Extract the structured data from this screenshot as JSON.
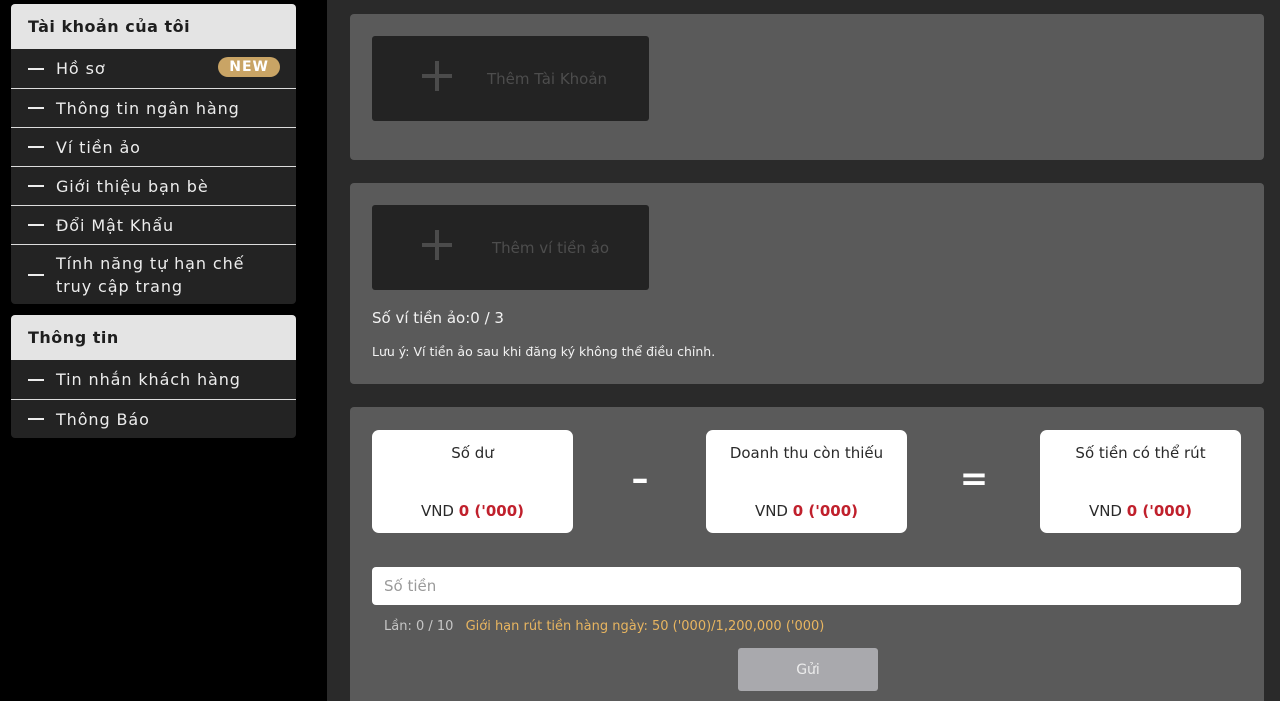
{
  "sidebar": {
    "account_panel": {
      "title": "Tài khoản của tôi",
      "items": [
        {
          "label": "Hồ sơ",
          "badge": "NEW"
        },
        {
          "label": "Thông tin ngân hàng"
        },
        {
          "label": "Ví tiền ảo"
        },
        {
          "label": "Giới thiệu bạn bè"
        },
        {
          "label": "Đổi Mật Khẩu"
        },
        {
          "label": "Tính năng tự hạn chế truy cập trang"
        }
      ]
    },
    "info_panel": {
      "title": "Thông tin",
      "items": [
        {
          "label": "Tin nhắn khách hàng"
        },
        {
          "label": "Thông Báo"
        }
      ]
    }
  },
  "main": {
    "add_account_label": "Thêm Tài Khoản",
    "add_wallet_label": "Thêm ví tiền ảo",
    "wallet_count_text": "Số ví tiền ảo:0 / 3",
    "wallet_note": "Lưu ý: Ví tiền ảo sau khi đăng ký không thể điều chỉnh.",
    "balance": {
      "title": "Số dư",
      "currency": "VND",
      "value": "0 ('000)"
    },
    "minus_symbol": "–",
    "shortfall": {
      "title": "Doanh thu còn thiếu",
      "currency": "VND",
      "value": "0 ('000)"
    },
    "equals_symbol": "=",
    "withdrawable": {
      "title": "Số tiền có thể rút",
      "currency": "VND",
      "value": "0 ('000)"
    },
    "amount_placeholder": "Số tiền",
    "times_text": "Lần: 0 / 10",
    "daily_limit_text": "Giới hạn rút tiền hàng ngày: 50 ('000)/1,200,000 ('000)",
    "submit_label": "Gửi"
  },
  "colors": {
    "accent_gold": "#c9a465",
    "value_red": "#c0202c",
    "limit_gold": "#e8b560"
  }
}
